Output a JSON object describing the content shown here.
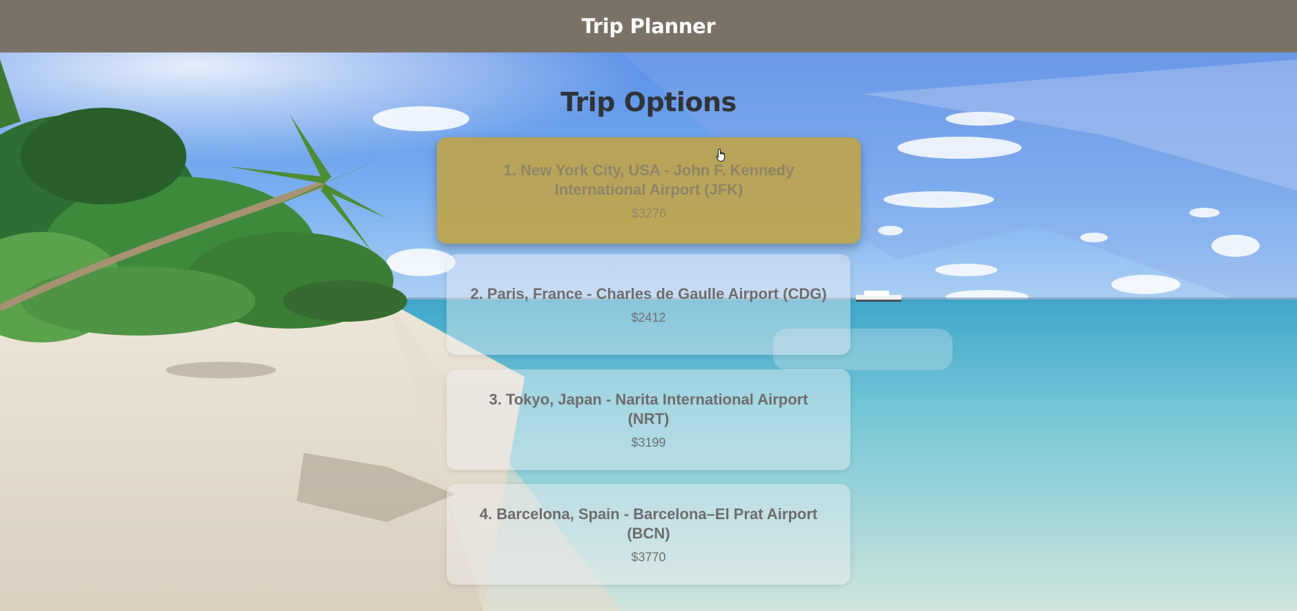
{
  "header": {
    "title": "Trip Planner"
  },
  "main": {
    "title": "Trip Options",
    "options": [
      {
        "name": "1. New York City, USA - John F. Kennedy International Airport (JFK)",
        "price": "$3276",
        "highlighted": true
      },
      {
        "name": "2. Paris, France - Charles de Gaulle Airport (CDG)",
        "price": "$2412",
        "highlighted": false
      },
      {
        "name": "3. Tokyo, Japan - Narita International Airport (NRT)",
        "price": "$3199",
        "highlighted": false
      },
      {
        "name": "4. Barcelona, Spain - Barcelona–El Prat Airport (BCN)",
        "price": "$3770",
        "highlighted": false
      }
    ]
  },
  "theme": {
    "header_color": "#7a7167",
    "highlight_color": "#c2a340",
    "title_color": "#2f3438"
  },
  "background": {
    "icon": "beach-background-image"
  },
  "cursor": {
    "icon": "hand-pointer-icon"
  }
}
